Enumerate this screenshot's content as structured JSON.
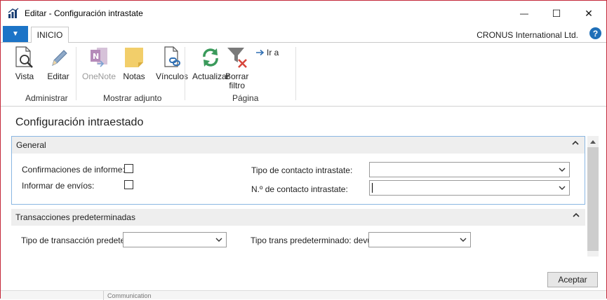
{
  "window": {
    "title": "Editar - Configuración intrastate",
    "controls": {
      "minimize": "—",
      "maximize": "☐",
      "close": "✕"
    }
  },
  "ribbon": {
    "menu_glyph": "▼",
    "tab": "INICIO",
    "company": "CRONUS International Ltd.",
    "help": "?",
    "buttons": {
      "vista": "Vista",
      "editar": "Editar",
      "onenote": "OneNote",
      "notas": "Notas",
      "vinculos": "Vínculos",
      "actualizar": "Actualizar",
      "borrar_filtro_1": "Borrar",
      "borrar_filtro_2": "filtro",
      "ir_a": "Ir a"
    },
    "groups": {
      "administrar": "Administrar",
      "mostrar_adjunto": "Mostrar adjunto",
      "pagina": "Página"
    }
  },
  "page": {
    "title": "Configuración intraestado"
  },
  "general": {
    "header": "General",
    "confirmaciones_label": "Confirmaciones de informe:",
    "informar_envios_label": "Informar de envíos:",
    "tipo_contacto_label": "Tipo de contacto intrastate:",
    "tipo_contacto_value": "",
    "no_contacto_label": "N.º de contacto intrastate:",
    "no_contacto_value": ""
  },
  "transacciones": {
    "header": "Transacciones predeterminadas",
    "tipo_trans_label": "Tipo de transacción predeterminado:",
    "tipo_trans_value": "",
    "tipo_trans_dev_label": "Tipo trans predeterminado: devuelve:",
    "tipo_trans_dev_value": ""
  },
  "footer": {
    "accept": "Aceptar",
    "background_text": "Communication"
  },
  "colors": {
    "accent": "#1c74c7",
    "window_border": "#c4283a",
    "general_border": "#8ab7e2"
  }
}
